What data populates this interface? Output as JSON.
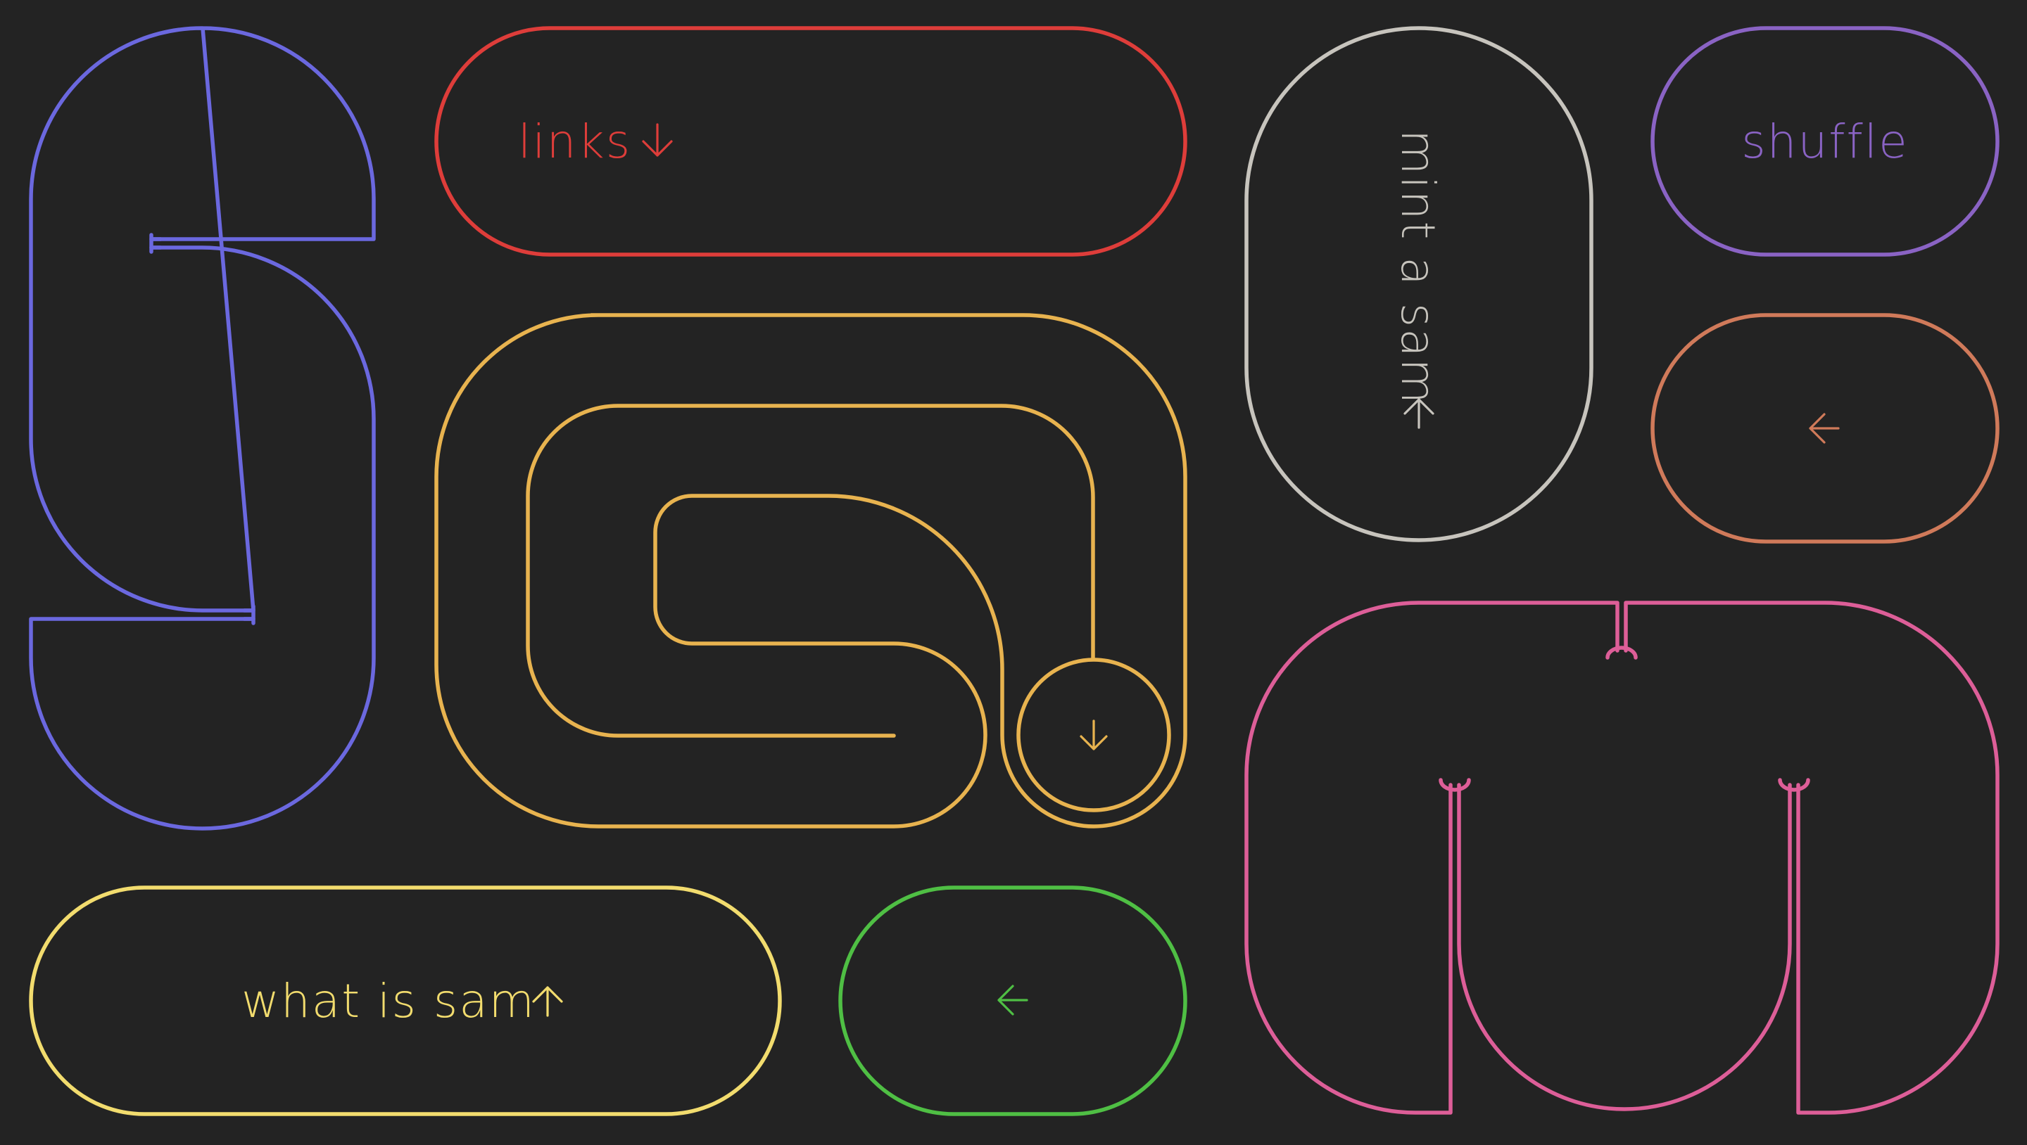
{
  "colors": {
    "background": "#232323",
    "s_letter": "#6b68df",
    "links": "#de3d3a",
    "a_letter": "#e8b34f",
    "mint": "#c7c4bd",
    "shuffle": "#8a63c4",
    "back_top": "#d07a5a",
    "m_letter": "#dd5e98",
    "what": "#f2dc6e",
    "back_bottom": "#4fbf44"
  },
  "buttons": {
    "links": {
      "label": "links",
      "icon": "arrow-down-icon"
    },
    "mint": {
      "label": "mint a sam",
      "icon": "arrow-left-icon"
    },
    "shuffle": {
      "label": "shuffle"
    },
    "back_top": {
      "icon": "arrow-left-icon"
    },
    "what": {
      "label": "what is sam",
      "icon": "arrow-up-icon"
    },
    "back_bottom": {
      "icon": "arrow-left-icon"
    },
    "scroll_down": {
      "icon": "arrow-down-icon"
    }
  },
  "logo": {
    "letters": [
      "s",
      "a",
      "m"
    ],
    "shapes": [
      "s-letter-shape",
      "a-letter-shape",
      "m-letter-shape"
    ]
  }
}
